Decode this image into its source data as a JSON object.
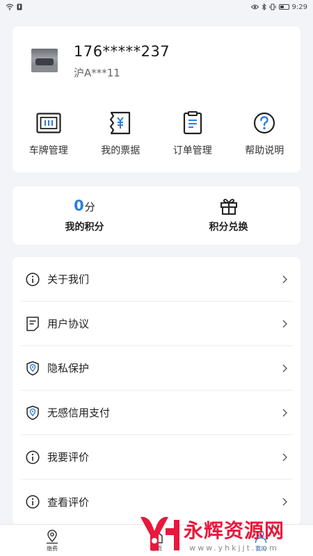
{
  "status_bar": {
    "time": "9:29"
  },
  "profile": {
    "phone": "176*****237",
    "plate": "沪A***11"
  },
  "quick_actions": [
    {
      "label": "车牌管理",
      "icon": "license-plate-icon"
    },
    {
      "label": "我的票据",
      "icon": "receipt-icon"
    },
    {
      "label": "订单管理",
      "icon": "order-icon"
    },
    {
      "label": "帮助说明",
      "icon": "help-icon"
    }
  ],
  "points": {
    "score_value": "0",
    "score_unit": "分",
    "score_label": "我的积分",
    "exchange_label": "积分兑换"
  },
  "menu": [
    {
      "label": "关于我们",
      "icon": "info-icon"
    },
    {
      "label": "用户协议",
      "icon": "document-icon"
    },
    {
      "label": "隐私保护",
      "icon": "shield-location-icon"
    },
    {
      "label": "无感信用支付",
      "icon": "shield-location-icon"
    },
    {
      "label": "我要评价",
      "icon": "info-icon"
    },
    {
      "label": "查看评价",
      "icon": "info-icon"
    }
  ],
  "tabbar": [
    {
      "label": "缴费",
      "icon": "location-pin-icon"
    },
    {
      "label": "首页",
      "icon": "home-icon"
    },
    {
      "label": "我的",
      "icon": "person-icon"
    }
  ],
  "watermark": {
    "brand": "永辉资源网",
    "url": "www.yhkjjt.com"
  },
  "colors": {
    "accent": "#2f7dd8",
    "watermark_red": "#e8193c"
  }
}
